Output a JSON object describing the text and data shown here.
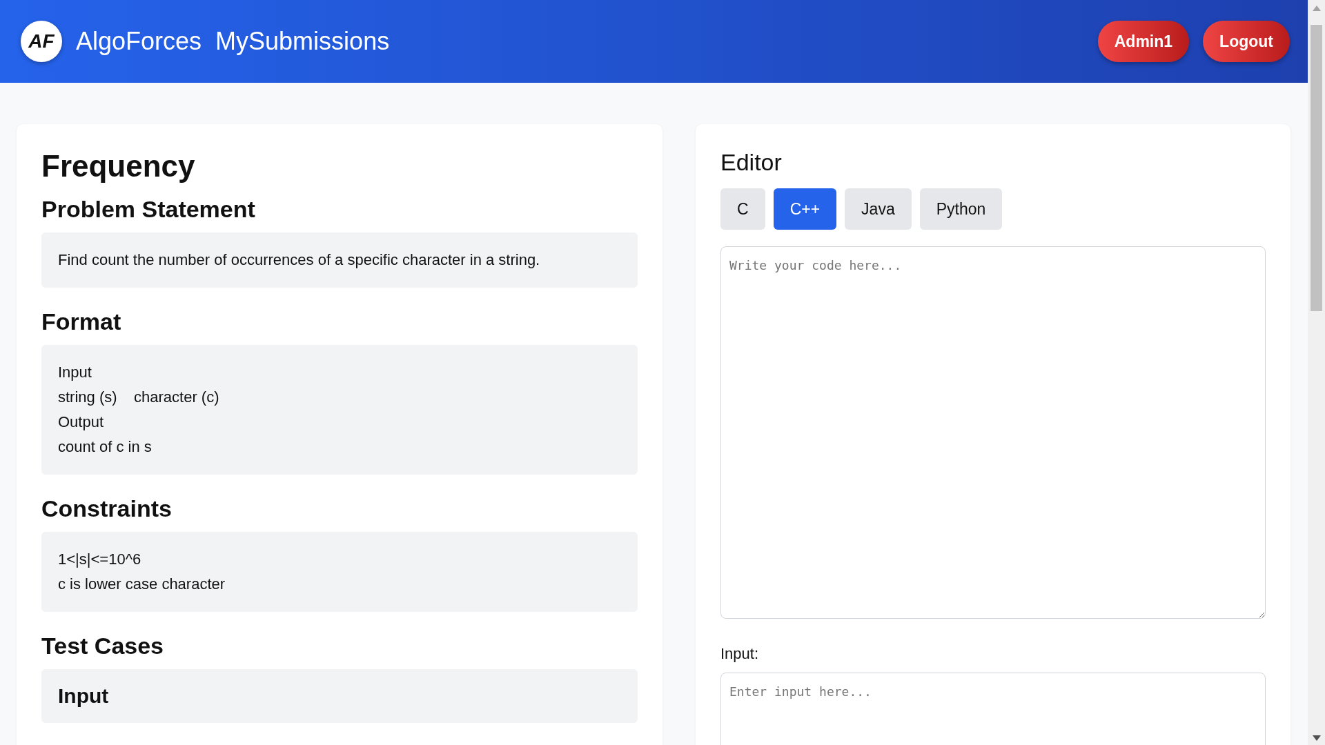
{
  "header": {
    "logo_text": "AF",
    "brand": "AlgoForces",
    "nav_link": "MySubmissions",
    "buttons": [
      "Admin1",
      "Logout"
    ]
  },
  "problem": {
    "title": "Frequency",
    "sections": [
      {
        "kind": "text",
        "heading": "Problem Statement",
        "lines": [
          "Find count the number of occurrences of a specific character in a string."
        ]
      },
      {
        "kind": "text",
        "heading": "Format",
        "lines": [
          "Input",
          "string (s)    character (c)",
          "Output",
          "count of c in s"
        ]
      },
      {
        "kind": "text",
        "heading": "Constraints",
        "lines": [
          "1<|s|<=10^6",
          "c is lower case character"
        ]
      },
      {
        "kind": "subheading",
        "heading": "Test Cases",
        "lines": [
          "Input"
        ]
      }
    ]
  },
  "editor": {
    "title": "Editor",
    "languages": [
      {
        "label": "C",
        "selected": false
      },
      {
        "label": "C++",
        "selected": true
      },
      {
        "label": "Java",
        "selected": false
      },
      {
        "label": "Python",
        "selected": false
      }
    ],
    "code_placeholder": "Write your code here...",
    "input_label": "Input:",
    "input_placeholder": "Enter input here..."
  }
}
